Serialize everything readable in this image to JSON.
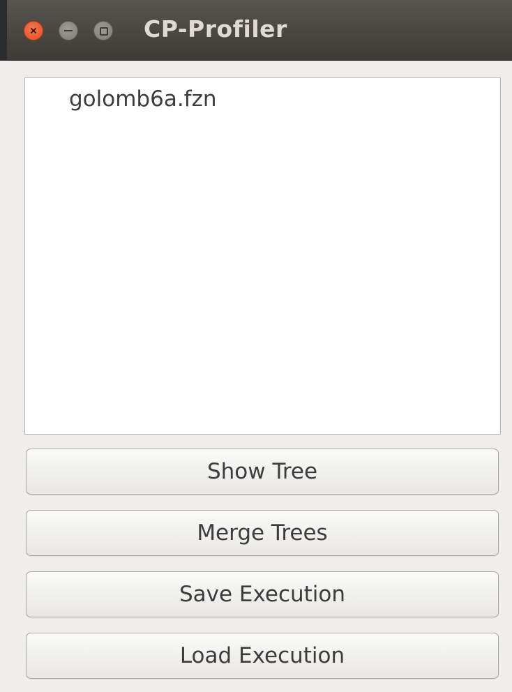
{
  "window": {
    "title": "CP-Profiler"
  },
  "executions_list": {
    "items": [
      {
        "label": "golomb6a.fzn"
      }
    ]
  },
  "actions": {
    "show_tree": "Show Tree",
    "merge_trees": "Merge Trees",
    "save_execution": "Save Execution",
    "load_execution": "Load Execution"
  },
  "colors": {
    "titlebar": "#46433f",
    "close_button": "#e8532b",
    "window_background": "#efeeec"
  }
}
